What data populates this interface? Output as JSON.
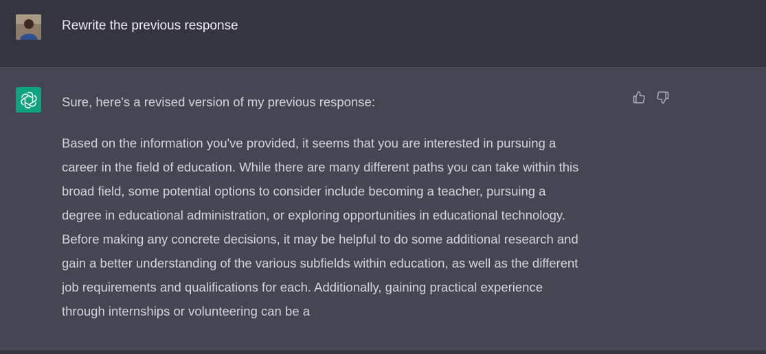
{
  "user_message": {
    "text": "Rewrite the previous response"
  },
  "assistant_message": {
    "intro": "Sure, here's a revised version of my previous response:",
    "lines": [
      "Based on the information you've provided, it seems that you are interested in pursuing a",
      "career in the field of education. While there are many different paths you can take within this",
      "broad field, some potential options to consider include becoming a teacher, pursuing a",
      "degree in educational administration, or exploring opportunities in educational technology.",
      "Before making any concrete decisions, it may be helpful to do some additional research and",
      "gain a better understanding of the various subfields within education, as well as the different",
      "job requirements and qualifications for each. Additionally, gaining practical experience",
      "through internships or volunteering can be a"
    ]
  },
  "feedback": {
    "thumbs_up_icon": "thumbs-up-icon",
    "thumbs_down_icon": "thumbs-down-icon"
  },
  "colors": {
    "user_bg": "#343541",
    "assistant_bg": "#444654",
    "bot_logo_bg": "#10a37f",
    "text": "#d1d5db"
  }
}
